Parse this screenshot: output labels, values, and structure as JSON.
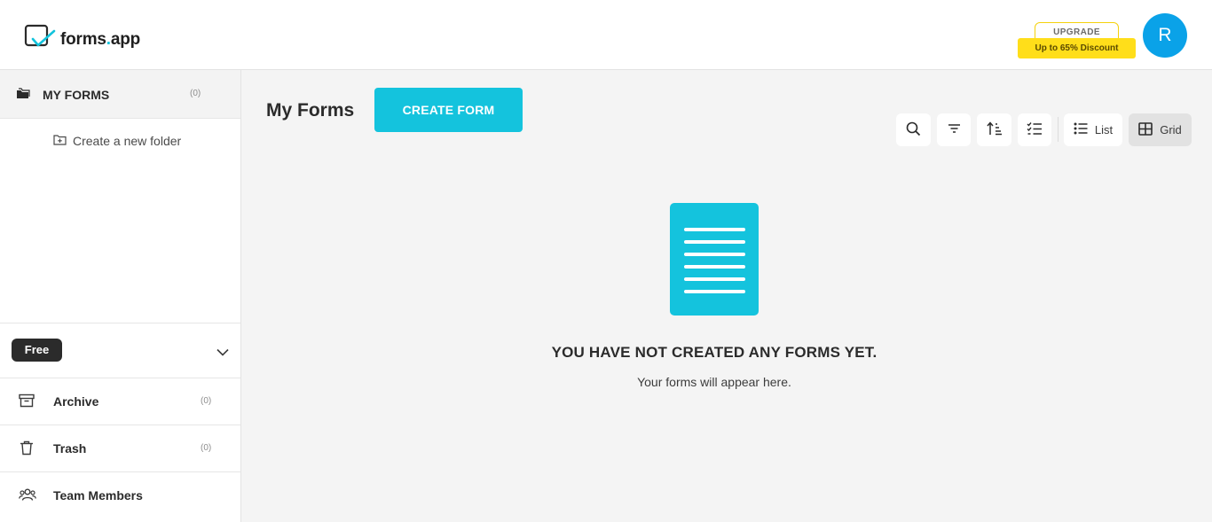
{
  "header": {
    "logo_text_main": "forms",
    "logo_text_dot": ".",
    "logo_text_suffix": "app",
    "upgrade_label": "UPGRADE",
    "upgrade_discount": "Up to 65% Discount",
    "avatar_initial": "R"
  },
  "sidebar": {
    "my_forms_label": "MY FORMS",
    "my_forms_count": "(0)",
    "new_folder_label": "Create a new folder",
    "plan_label": "Free",
    "items": [
      {
        "label": "Archive",
        "count": "(0)",
        "icon": "archive-icon"
      },
      {
        "label": "Trash",
        "count": "(0)",
        "icon": "trash-icon"
      },
      {
        "label": "Team Members",
        "count": "",
        "icon": "team-icon"
      }
    ]
  },
  "main": {
    "title": "My Forms",
    "create_button": "CREATE FORM",
    "toolbar": {
      "search_icon": "search-icon",
      "filter_icon": "filter-icon",
      "sort_icon": "sort-icon",
      "select_icon": "checklist-icon",
      "list_label": "List",
      "grid_label": "Grid",
      "active_view": "Grid"
    },
    "empty_title": "YOU HAVE NOT CREATED ANY FORMS YET.",
    "empty_subtitle": "Your forms will appear here."
  },
  "colors": {
    "accent": "#14c3dd",
    "avatar": "#0aa2e8",
    "upgrade": "#ffde1a",
    "plan_badge": "#2b2b2b"
  }
}
